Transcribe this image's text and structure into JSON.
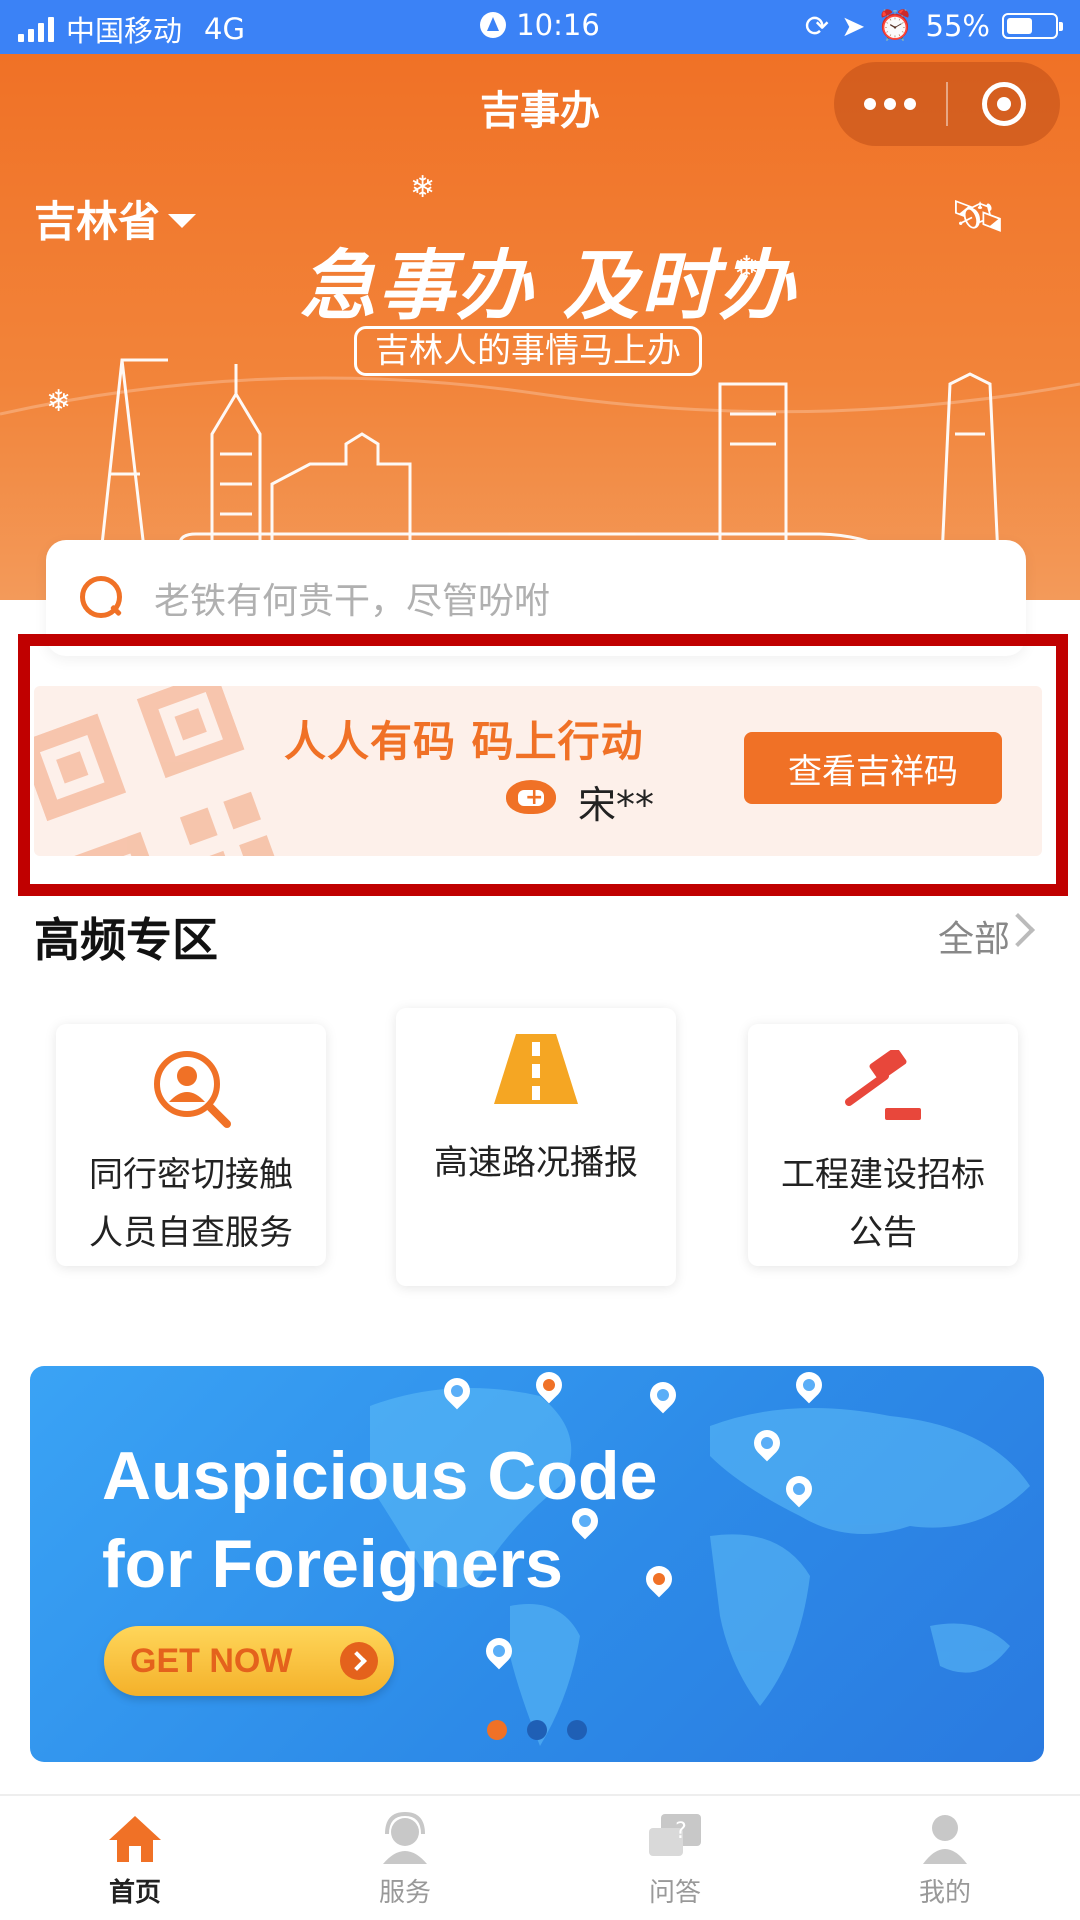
{
  "status_bar": {
    "carrier": "中国移动",
    "network": "4G",
    "time": "10:16",
    "battery": "55%",
    "battery_level": 0.55
  },
  "header": {
    "title": "吉事办",
    "menu_icon": "more-dots-icon",
    "close_icon": "target-circle-icon"
  },
  "hero": {
    "province": "吉林省",
    "slogan": "急事办 及时办",
    "subtitle": "吉林人的事情马上办"
  },
  "search": {
    "placeholder": "老铁有何贵干，尽管吩咐"
  },
  "code_banner": {
    "title": "人人有码 码上行动",
    "user_name": "宋**",
    "button_label": "查看吉祥码"
  },
  "high_frequency": {
    "title": "高频专区",
    "more_label": "全部",
    "items": [
      {
        "line1": "同行密切接触",
        "line2": "人员自查服务",
        "icon": "person-search-icon"
      },
      {
        "line1": "高速路况播报",
        "line2": "",
        "icon": "highway-icon"
      },
      {
        "line1": "工程建设招标",
        "line2": "公告",
        "icon": "gavel-icon"
      }
    ]
  },
  "promo_banner": {
    "title_line1": "Auspicious Code",
    "title_line2": "for Foreigners",
    "button_label": "GET NOW",
    "slide_count": 3,
    "active_slide": 1
  },
  "tabbar": {
    "items": [
      {
        "label": "首页",
        "icon": "home-icon",
        "active": true
      },
      {
        "label": "服务",
        "icon": "customer-service-icon",
        "active": false
      },
      {
        "label": "问答",
        "icon": "qa-chat-icon",
        "active": false
      },
      {
        "label": "我的",
        "icon": "profile-icon",
        "active": false
      }
    ]
  },
  "colors": {
    "primary_orange": "#f07126",
    "status_bar_blue": "#3b82f6",
    "highlight_red": "#c00000",
    "banner_blue": "#2d8be8"
  }
}
